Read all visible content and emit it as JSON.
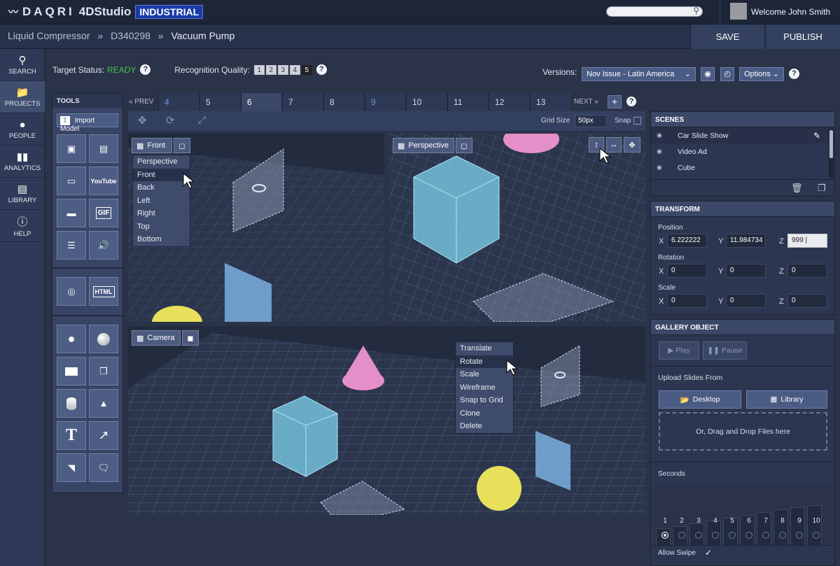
{
  "header": {
    "logo_text": "DAQRI",
    "product": "4DStudio",
    "edition": "INDUSTRIAL",
    "search_placeholder": "",
    "welcome": "Welcome John Smith"
  },
  "breadcrumbs": [
    "Liquid Compressor",
    "D340298",
    "Vacuum Pump"
  ],
  "breadcrumb_sep": "»",
  "actions": {
    "save": "SAVE",
    "publish": "PUBLISH"
  },
  "nav": [
    {
      "label": "SEARCH",
      "icon": "search-icon"
    },
    {
      "label": "PROJECTS",
      "icon": "folder-icon",
      "active": true
    },
    {
      "label": "PEOPLE",
      "icon": "person-icon"
    },
    {
      "label": "ANALYTICS",
      "icon": "bar-chart-icon"
    },
    {
      "label": "LIBRARY",
      "icon": "document-icon"
    },
    {
      "label": "HELP",
      "icon": "help-icon"
    }
  ],
  "status": {
    "target_label": "Target Status:",
    "target_value": "READY",
    "quality_label": "Recognition Quality:",
    "quality_levels": [
      "1",
      "2",
      "3",
      "4",
      "5"
    ],
    "quality_selected": "5"
  },
  "versions": {
    "label": "Versions:",
    "selected": "Nov Issue - Latin America",
    "options_label": "Options"
  },
  "tools": {
    "title": "TOOLS",
    "import_label": "Import Model",
    "youtube_label": "YouTube",
    "gif_label": "GIF",
    "html_label": "HTML",
    "text_label": "T"
  },
  "pages": {
    "prev": "« PREV",
    "next": "NEXT »",
    "tabs": [
      {
        "n": "4",
        "style": "blue"
      },
      {
        "n": "5",
        "style": ""
      },
      {
        "n": "6",
        "style": "active"
      },
      {
        "n": "7",
        "style": ""
      },
      {
        "n": "8",
        "style": ""
      },
      {
        "n": "9",
        "style": "blue"
      },
      {
        "n": "10",
        "style": ""
      },
      {
        "n": "11",
        "style": ""
      },
      {
        "n": "12",
        "style": ""
      },
      {
        "n": "13",
        "style": ""
      }
    ],
    "plus": "+"
  },
  "toolbar": {
    "grid_size_label": "Grid Size",
    "grid_size_value": "50px",
    "snap_label": "Snap"
  },
  "viewports": {
    "front": {
      "label": "Front",
      "menu": [
        "Perspective",
        "Front",
        "Back",
        "Left",
        "Right",
        "Top",
        "Bottom"
      ],
      "menu_selected": "Front"
    },
    "perspective": {
      "label": "Perspective"
    },
    "camera": {
      "label": "Camera",
      "menu": [
        "Translate",
        "Rotate",
        "Scale",
        "Wireframe",
        "Snap to Grid",
        "Clone",
        "Delete"
      ],
      "menu_selected": "Rotate"
    }
  },
  "scenes": {
    "title": "SCENES",
    "items": [
      "Car Slide Show",
      "Video Ad",
      "Cube"
    ],
    "selected": "Car Slide Show"
  },
  "transform": {
    "title": "TRANSFORM",
    "position_label": "Position",
    "rotation_label": "Rotation",
    "scale_label": "Scale",
    "axes": [
      "X",
      "Y",
      "Z"
    ],
    "position": [
      "6.222222",
      "11.984734",
      "999 |"
    ],
    "rotation": [
      "0",
      "0",
      "0"
    ],
    "scale": [
      "0",
      "0",
      "0"
    ]
  },
  "gallery": {
    "title": "GALLERY OBJECT",
    "play": "▶ Play",
    "pause": "❚❚ Pause",
    "upload_label": "Upload Slides From",
    "desktop": "Desktop",
    "library": "Library",
    "drop_text": "Or, Drag and Drop Files here",
    "seconds_label": "Seconds",
    "seconds": [
      "1",
      "2",
      "3",
      "4",
      "5",
      "6",
      "7",
      "8",
      "9",
      "10"
    ],
    "seconds_selected": "1",
    "allow_swipe_label": "Allow Swipe",
    "allow_swipe": true
  },
  "colors": {
    "accent": "#4a5b84",
    "ready": "#49c24f",
    "tab_blue": "#6b9ae8",
    "cube": "#7fd3ee",
    "cone": "#e58fc8",
    "sphere": "#e8e05a"
  }
}
